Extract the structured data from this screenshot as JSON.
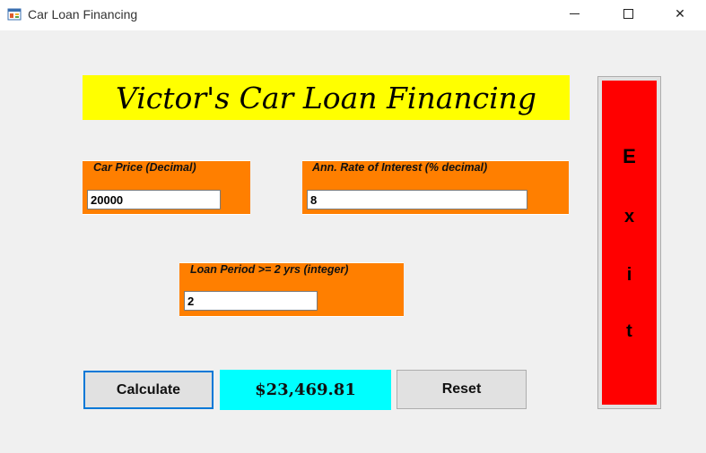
{
  "window": {
    "title": "Car Loan Financing",
    "controls": {
      "minimize": "minimize",
      "maximize": "maximize",
      "close": "✕"
    }
  },
  "banner": {
    "text": "Victor's Car Loan Financing"
  },
  "car_price": {
    "label": "Car Price (Decimal)",
    "value": "20000"
  },
  "interest_rate": {
    "label": "Ann. Rate of Interest (% decimal)",
    "value": "8"
  },
  "loan_period": {
    "label": "Loan Period >= 2 yrs (integer)",
    "value": "2"
  },
  "buttons": {
    "calculate": "Calculate",
    "reset": "Reset",
    "exit_letters": [
      "E",
      "x",
      "i",
      "t"
    ]
  },
  "result": {
    "amount": "$23,469.81"
  },
  "colors": {
    "banner": "#ffff00",
    "groupbox": "#ff7f00",
    "result": "#00ffff",
    "exit": "#ff0000",
    "focus": "#0078d7"
  },
  "icons": {
    "app": "winforms-app-icon"
  }
}
